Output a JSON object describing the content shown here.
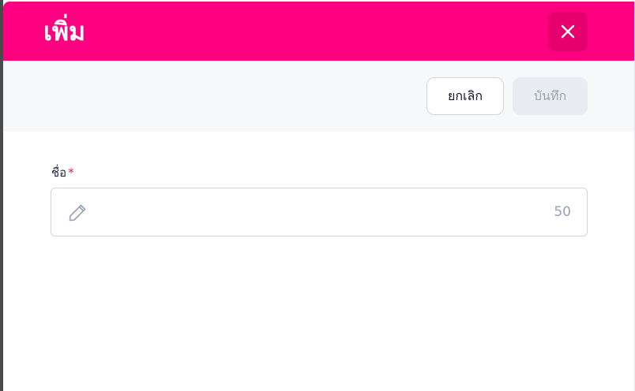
{
  "dialog": {
    "title": "เพิ่ม",
    "close_icon": "close-icon"
  },
  "toolbar": {
    "cancel_label": "ยกเลิก",
    "save_label": "บันทึก",
    "save_enabled": false
  },
  "form": {
    "name_field": {
      "label": "ชื่อ",
      "required_mark": "*",
      "value": "",
      "icon": "pencil-icon",
      "char_limit": "50"
    }
  },
  "colors": {
    "header": "#ff0080",
    "close_button": "#e6006e",
    "toolbar_bg": "#f7f8fa",
    "required": "#e11d48"
  }
}
